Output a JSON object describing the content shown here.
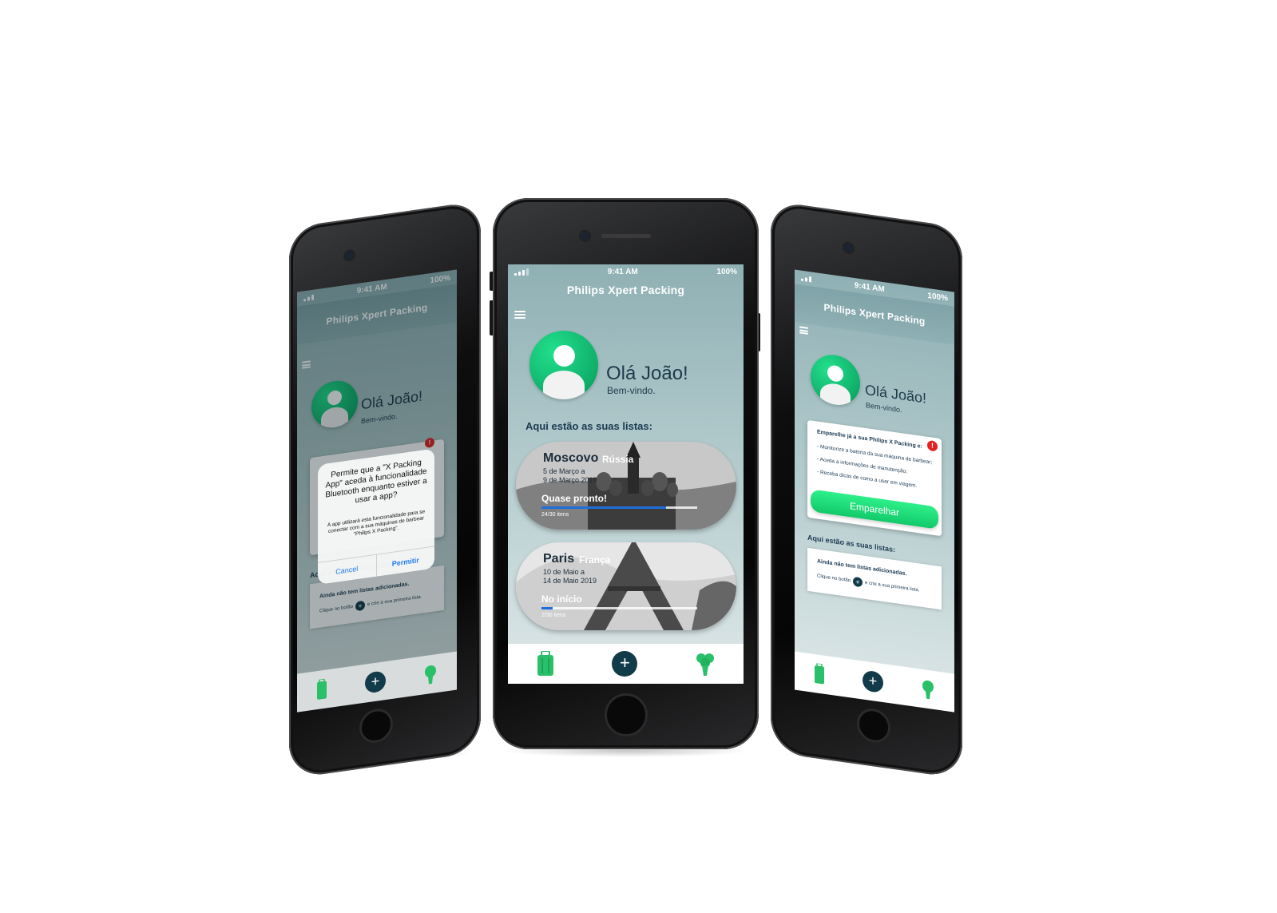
{
  "status": {
    "time": "9:41 AM",
    "battery": "100%"
  },
  "app": {
    "title": "Philips Xpert Packing"
  },
  "greeting": {
    "hello": "Olá João!",
    "welcome": "Bem-vindo."
  },
  "lists_heading": "Aqui estão as suas listas:",
  "trips": [
    {
      "city": "Moscovo",
      "country": "Rússia",
      "date_from": "5 de Março a",
      "date_to": "9 de Março 2019",
      "status": "Quase pronto!",
      "items": "24/30 itens",
      "progress": 0.8
    },
    {
      "city": "Paris",
      "country": "França",
      "date_from": "10 de Maio a",
      "date_to": "14 de Maio 2019",
      "status": "No início",
      "items": "2/30 itens",
      "progress": 0.07
    }
  ],
  "pairing": {
    "title": "Emparelhe já a sua Philips X Packing e:",
    "bullets": [
      "- Monitorize a bateria da sua máquina de barbear;",
      "- Aceda a informações de manutenção;",
      "- Receba dicas de como a usar em viagem."
    ],
    "button": "Emparelhar"
  },
  "empty_state": {
    "line1": "Ainda não tem listas adicionadas.",
    "line2a": "Clique no botão",
    "line2b": "e crie a sua primeira lista."
  },
  "bluetooth_dialog": {
    "title": "Permite que a \"X Packing App\" aceda à funcionalidade Bluetooth enquanto estiver a usar a app?",
    "message": "A app utilizará esta funcionalidade para se conectar com a sua máquinas de barbear \"Philips X Packing\".",
    "cancel": "Cancel",
    "allow": "Permitir"
  },
  "tabs": {
    "add": "+",
    "luggage_icon": "luggage-icon",
    "shaver_icon": "shaver-icon"
  },
  "alert_mark": "!",
  "colors": {
    "accent_green": "#13c96a",
    "navy": "#123b4a",
    "progress_blue": "#1e6fdc",
    "alert_red": "#e32323"
  }
}
